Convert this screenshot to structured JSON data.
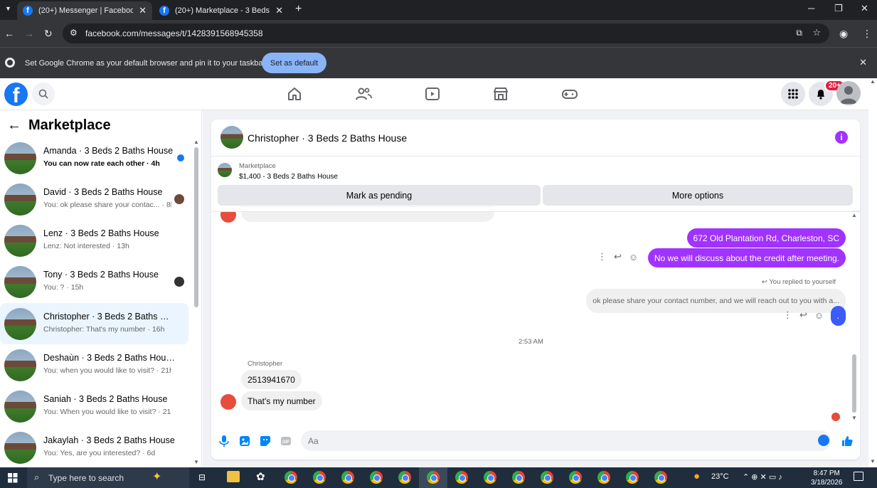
{
  "browser": {
    "tabs": [
      {
        "title": "(20+) Messenger | Facebook"
      },
      {
        "title": "(20+) Marketplace - 3 Beds 2 B"
      }
    ],
    "url": "facebook.com/messages/t/1428391568945358",
    "infobar_message": "Set Google Chrome as your default browser and pin it to your taskbar",
    "infobar_button": "Set as default"
  },
  "fb_nav": {
    "notification_badge": "20+"
  },
  "sidebar": {
    "title": "Marketplace",
    "conversations": [
      {
        "name": "Amanda · 3 Beds 2 Baths House",
        "preview": "You can now rate each other · 4h",
        "unread": true
      },
      {
        "name": "David · 3 Beds 2 Baths House",
        "preview": "You: ok please share your contac... · 8h"
      },
      {
        "name": "Lenz · 3 Beds 2 Baths House",
        "preview": "Lenz: Not interested · 13h"
      },
      {
        "name": "Tony · 3 Beds 2 Baths House",
        "preview": "You: ? · 15h"
      },
      {
        "name": "Christopher · 3 Beds 2 Baths Ho...",
        "preview": "Christopher: That's my number · 16h"
      },
      {
        "name": "Deshaùn · 3 Beds 2 Baths House",
        "preview": "You: when you would like to visit? · 21h"
      },
      {
        "name": "Saniah · 3 Beds 2 Baths House",
        "preview": "You: When you would like to visit? · 21h"
      },
      {
        "name": "Jakaylah · 3 Beds 2 Baths House",
        "preview": "You: Yes, are you interested? · 6d"
      }
    ]
  },
  "chat": {
    "header_name": "Christopher · 3 Beds 2 Baths House",
    "listing_label": "Marketplace",
    "listing_price": "$1,400 - 3 Beds 2 Baths House",
    "mark_pending": "Mark as pending",
    "more_options": "More options",
    "messages": {
      "address": "672 Old Plantation Rd, Charleston, SC",
      "credit": "No we will discuss about the credit after meeting.",
      "replied_label": "You replied to yourself",
      "replied_quote": "ok please share your contact number, and we will reach out to you with a...",
      "dot_msg": ".",
      "timestamp": "2:53 AM",
      "sender": "Christopher",
      "number": "2513941670",
      "number_note": "That's my number"
    },
    "composer_placeholder": "Aa"
  },
  "taskbar": {
    "search_placeholder": "Type here to search",
    "temperature": "23°C",
    "time": "8:47 PM",
    "date": "3/18/2026"
  }
}
